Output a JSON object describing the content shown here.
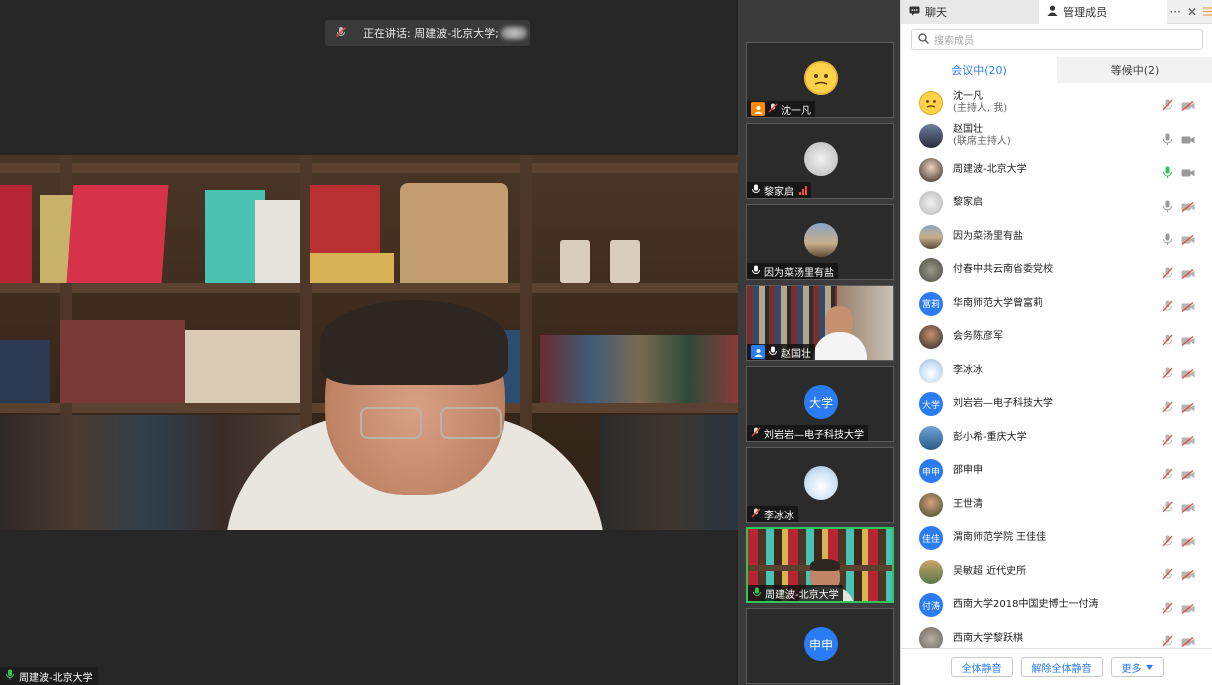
{
  "stage": {
    "speaking_prefix": "正在讲话: 周建波-北京大学;",
    "bottom_label": "周建波-北京大学"
  },
  "thumbnails": [
    {
      "name": "沈一凡",
      "avatar_type": "emoji",
      "badge": "host",
      "mic": "muted"
    },
    {
      "name": "黎家启",
      "avatar_type": "photo",
      "badge": "",
      "mic": "on",
      "signal": true
    },
    {
      "name": "因为菜汤里有盐",
      "avatar_type": "photo",
      "badge": "",
      "mic": "on"
    },
    {
      "name": "赵国壮",
      "avatar_type": "video",
      "badge": "cohost",
      "mic": "on"
    },
    {
      "name": "刘岩岩—电子科技大学",
      "avatar_type": "text",
      "avatar_text": "大学",
      "badge": "",
      "mic": "muted"
    },
    {
      "name": "李冰冰",
      "avatar_type": "photo",
      "badge": "",
      "mic": "muted"
    },
    {
      "name": "周建波-北京大学",
      "avatar_type": "video",
      "badge": "",
      "mic": "speaking",
      "active": true
    },
    {
      "name": "",
      "avatar_type": "text",
      "avatar_text": "申申",
      "badge": "",
      "mic": ""
    }
  ],
  "panel": {
    "tab_chat": "聊天",
    "tab_members": "管理成员",
    "more_glyph": "···",
    "close_glyph": "✕",
    "search_placeholder": "搜索成员",
    "in_meeting": "会议中(20)",
    "waiting": "等候中(2)",
    "members": [
      {
        "name": "沈一凡",
        "sub": "(主持人, 我)",
        "avatar": "emoji",
        "mic": "muted",
        "cam": "off"
      },
      {
        "name": "赵国壮",
        "sub": "(联席主持人)",
        "avatar": "photo",
        "mic": "on",
        "cam": "on"
      },
      {
        "name": "周建波-北京大学",
        "sub": "",
        "avatar": "photo",
        "mic": "speaking",
        "cam": "on"
      },
      {
        "name": "黎家启",
        "sub": "",
        "avatar": "photo",
        "mic": "on",
        "cam": "off"
      },
      {
        "name": "因为菜汤里有盐",
        "sub": "",
        "avatar": "photo",
        "mic": "on",
        "cam": "off"
      },
      {
        "name": "付春中共云南省委党校",
        "sub": "",
        "avatar": "photo",
        "mic": "muted",
        "cam": "off"
      },
      {
        "name": "华南师范大学曾富莉",
        "sub": "",
        "avatar": "text",
        "avatar_text": "富莉",
        "mic": "muted",
        "cam": "off"
      },
      {
        "name": "会务陈彦军",
        "sub": "",
        "avatar": "photo",
        "mic": "muted",
        "cam": "off"
      },
      {
        "name": "李冰冰",
        "sub": "",
        "avatar": "photo",
        "mic": "muted",
        "cam": "off"
      },
      {
        "name": "刘岩岩—电子科技大学",
        "sub": "",
        "avatar": "text",
        "avatar_text": "大学",
        "mic": "muted",
        "cam": "off"
      },
      {
        "name": "彭小希-重庆大学",
        "sub": "",
        "avatar": "photo",
        "mic": "muted",
        "cam": "off"
      },
      {
        "name": "邵申申",
        "sub": "",
        "avatar": "text",
        "avatar_text": "申申",
        "mic": "muted",
        "cam": "off"
      },
      {
        "name": "王世清",
        "sub": "",
        "avatar": "photo",
        "mic": "muted",
        "cam": "off"
      },
      {
        "name": "渭南师范学院 王佳佳",
        "sub": "",
        "avatar": "text",
        "avatar_text": "佳佳",
        "mic": "muted",
        "cam": "off"
      },
      {
        "name": "吴敏超 近代史所",
        "sub": "",
        "avatar": "photo",
        "mic": "muted",
        "cam": "off"
      },
      {
        "name": "西南大学2018中国史博士一付涛",
        "sub": "",
        "avatar": "text",
        "avatar_text": "付涛",
        "mic": "muted",
        "cam": "off"
      },
      {
        "name": "西南大学黎跃棋",
        "sub": "",
        "avatar": "photo",
        "mic": "muted",
        "cam": "off"
      }
    ],
    "footer": {
      "mute_all": "全体静音",
      "unmute_all": "解除全体静音",
      "more": "更多"
    }
  },
  "colors": {
    "accent": "#2b7cf3",
    "speaking": "#2ec65a",
    "muted": "#e24a3b",
    "host_badge": "#ff8a00"
  }
}
